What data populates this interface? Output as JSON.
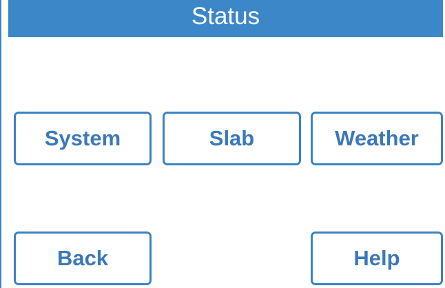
{
  "header": {
    "title": "Status"
  },
  "buttons": {
    "system": "System",
    "slab": "Slab",
    "weather": "Weather",
    "back": "Back",
    "help": "Help"
  },
  "colors": {
    "accent": "#3b87c8",
    "button_border": "#3b82c4",
    "button_text": "#3b78b8",
    "title_text": "#ffffff",
    "background": "#ffffff"
  }
}
